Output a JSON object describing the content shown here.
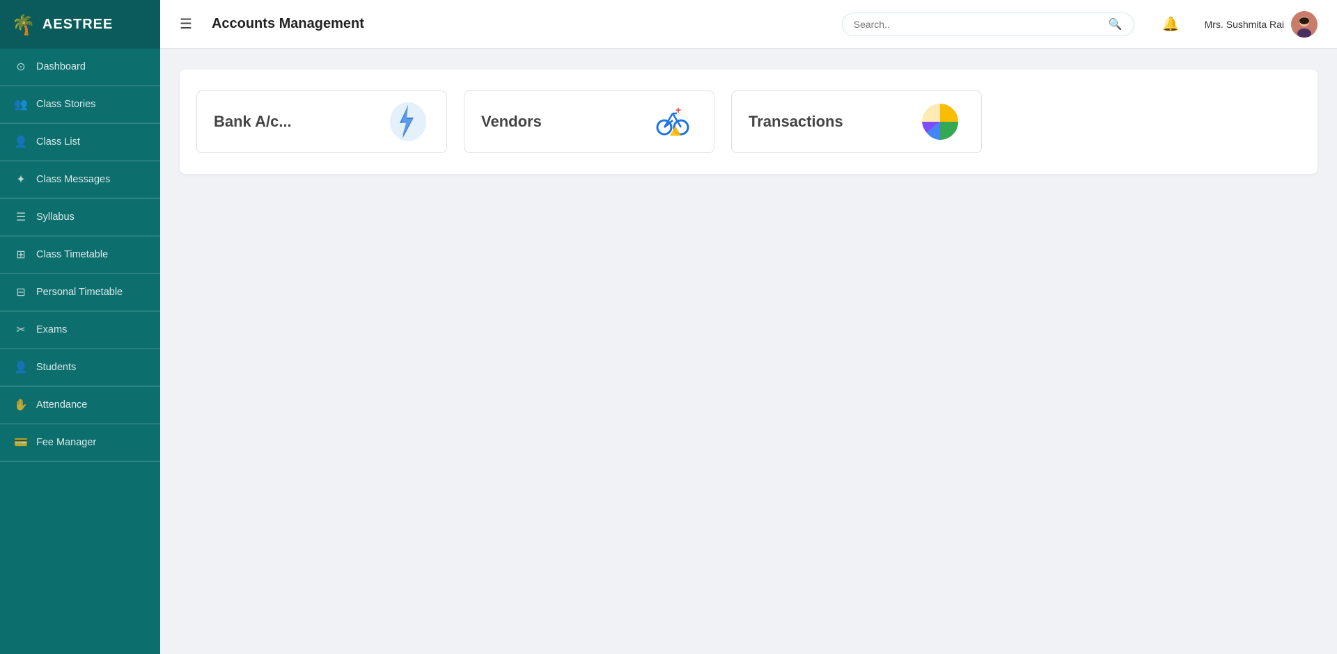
{
  "sidebar": {
    "logo_icon": "🌴",
    "logo_text": "AESTREE",
    "items": [
      {
        "id": "dashboard",
        "label": "Dashboard",
        "icon": "⊙"
      },
      {
        "id": "class-stories",
        "label": "Class Stories",
        "icon": "👥"
      },
      {
        "id": "class-list",
        "label": "Class List",
        "icon": "👤"
      },
      {
        "id": "class-messages",
        "label": "Class Messages",
        "icon": "✦"
      },
      {
        "id": "syllabus",
        "label": "Syllabus",
        "icon": "☰"
      },
      {
        "id": "class-timetable",
        "label": "Class Timetable",
        "icon": "⊞"
      },
      {
        "id": "personal-timetable",
        "label": "Personal Timetable",
        "icon": "⊟"
      },
      {
        "id": "exams",
        "label": "Exams",
        "icon": "✂"
      },
      {
        "id": "students",
        "label": "Students",
        "icon": "👤"
      },
      {
        "id": "attendance",
        "label": "Attendance",
        "icon": "✋"
      },
      {
        "id": "fee-manager",
        "label": "Fee Manager",
        "icon": "💳"
      }
    ]
  },
  "header": {
    "menu_icon": "☰",
    "title": "Accounts Management",
    "search_placeholder": "Search..",
    "user_name": "Mrs. Sushmita Rai"
  },
  "cards": [
    {
      "id": "bank-account",
      "label": "Bank A/c..."
    },
    {
      "id": "vendors",
      "label": "Vendors"
    },
    {
      "id": "transactions",
      "label": "Transactions"
    }
  ]
}
